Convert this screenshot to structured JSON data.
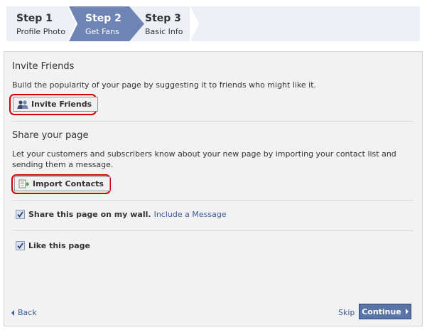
{
  "wizard": {
    "steps": [
      {
        "title": "Step 1",
        "subtitle": "Profile Photo",
        "active": false
      },
      {
        "title": "Step 2",
        "subtitle": "Get Fans",
        "active": true
      },
      {
        "title": "Step 3",
        "subtitle": "Basic Info",
        "active": false
      }
    ],
    "active_color": "#6d84b4"
  },
  "invite": {
    "title": "Invite Friends",
    "description": "Build the popularity of your page by suggesting it to friends who might like it.",
    "button_label": "Invite Friends",
    "button_icon": "friends-icon"
  },
  "share": {
    "title": "Share your page",
    "description": "Let your customers and subscribers know about your new page by importing your contact list and sending them a message.",
    "button_label": "Import Contacts",
    "button_icon": "import-contacts-icon"
  },
  "options": {
    "share_wall": {
      "label": "Share this page on my wall.",
      "link": "Include a Message",
      "checked": true
    },
    "like_page": {
      "label": "Like this page",
      "checked": true
    }
  },
  "footer": {
    "back_label": "Back",
    "skip_label": "Skip",
    "continue_label": "Continue"
  },
  "colors": {
    "highlight_ring": "#d40000",
    "link": "#3b5998",
    "primary_button": "#5b74a8"
  }
}
